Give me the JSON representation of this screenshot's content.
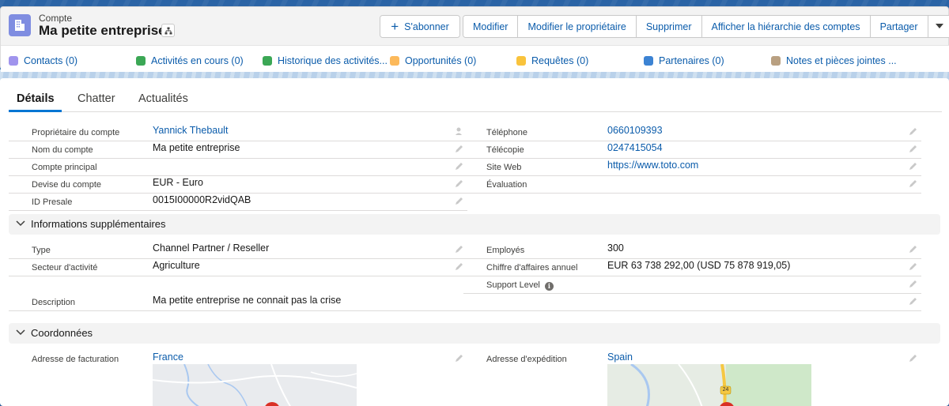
{
  "header": {
    "object_label": "Compte",
    "record_title": "Ma petite entreprise",
    "actions": {
      "follow": "S'abonner",
      "edit": "Modifier",
      "change_owner": "Modifier le propriétaire",
      "delete": "Supprimer",
      "view_hierarchy": "Afficher la hiérarchie des comptes",
      "share": "Partager"
    }
  },
  "related_links": [
    {
      "label": "Contacts (0)",
      "color": "#a094ed"
    },
    {
      "label": "Activités en cours (0)",
      "color": "#3ba755"
    },
    {
      "label": "Historique des activités...",
      "color": "#3ba755"
    },
    {
      "label": "Opportunités (0)",
      "color": "#fcb95b"
    },
    {
      "label": "Requêtes (0)",
      "color": "#f9c33c"
    },
    {
      "label": "Partenaires (0)",
      "color": "#3c83d3"
    },
    {
      "label": "Notes et pièces jointes ...",
      "color": "#b9a081"
    }
  ],
  "tabs": [
    "Détails",
    "Chatter",
    "Actualités"
  ],
  "details": {
    "left": [
      {
        "label": "Propriétaire du compte",
        "value": "Yannick Thebault",
        "link": true
      },
      {
        "label": "Nom du compte",
        "value": "Ma petite entreprise",
        "link": false
      },
      {
        "label": "Compte principal",
        "value": "",
        "link": false
      },
      {
        "label": "Devise du compte",
        "value": "EUR - Euro",
        "link": false
      },
      {
        "label": "ID Presale",
        "value": "0015I00000R2vidQAB",
        "link": false
      }
    ],
    "right": [
      {
        "label": "Téléphone",
        "value": "0660109393",
        "link": true
      },
      {
        "label": "Télécopie",
        "value": "0247415054",
        "link": true
      },
      {
        "label": "Site Web",
        "value": "https://www.toto.com",
        "link": true
      },
      {
        "label": "Évaluation",
        "value": "",
        "link": false
      }
    ]
  },
  "sections": {
    "additional": {
      "title": "Informations supplémentaires",
      "type_label": "Type",
      "type_value": "Channel Partner / Reseller",
      "industry_label": "Secteur d'activité",
      "industry_value": "Agriculture",
      "description_label": "Description",
      "description_value": "Ma petite entreprise ne connait pas la crise",
      "employees_label": "Employés",
      "employees_value": "300",
      "revenue_label": "Chiffre d'affaires annuel",
      "revenue_value": "EUR 63 738 292,00 (USD 75 878 919,05)",
      "support_label": "Support Level",
      "support_value": ""
    },
    "address": {
      "title": "Coordonnées",
      "billing_label": "Adresse de facturation",
      "billing_value": "France",
      "shipping_label": "Adresse d'expédition",
      "shipping_value": "Spain",
      "map_road_number": "24"
    }
  }
}
